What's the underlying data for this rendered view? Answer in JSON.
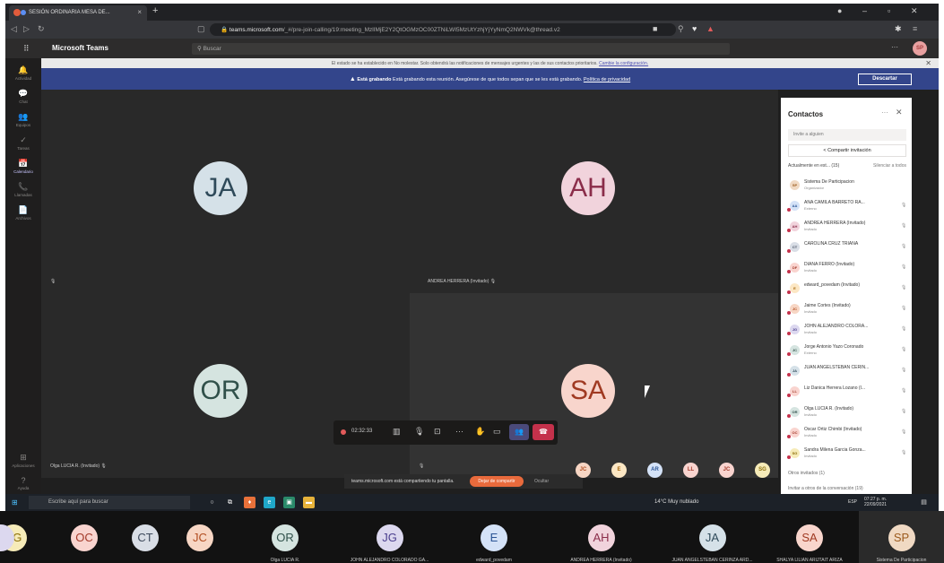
{
  "browser": {
    "tab_title": "SESIÓN ORDINARIA MESA DE...",
    "url_host": "teams.microsoft.com",
    "url_path": "/_#/pre-join-calling/19:meeting_MzlIMjE2Y2QtOGMzOC00ZTNiLWI5MzUtYzhjYjYyNmQ2NWVk@thread.v2"
  },
  "teams": {
    "app_title": "Microsoft Teams",
    "search_placeholder": "Buscar",
    "user_initials": "SP",
    "rail": [
      "Actividad",
      "Chat",
      "Equipos",
      "Tareas",
      "Calendario",
      "Llamadas",
      "Archivos",
      "Aplicaciones",
      "Ayuda"
    ]
  },
  "notice": {
    "text": "El estado se ha establecido en No molestar. Solo obtendrá las notificaciones de mensajes urgentes y las de sus contactos prioritarios.",
    "link": "Cambie la configuración."
  },
  "recording": {
    "bold": "Está grabando",
    "text": "Está grabando esta reunión. Asegúrese de que todos sepan que se les está grabando.",
    "link": "Política de privacidad",
    "stop_label": "Descartar"
  },
  "tiles": [
    {
      "initials": "JA",
      "name": "",
      "bg": "#d5e1e8",
      "fg": "#2f4a5a"
    },
    {
      "initials": "AH",
      "name": "ANDREA HERRERA (Invitado)",
      "bg": "#f1d3dc",
      "fg": "#8b2d4a"
    },
    {
      "initials": "OR",
      "name": "Olga LUCIA R. (Invitado)",
      "bg": "#d5e4e0",
      "fg": "#30504a"
    },
    {
      "initials": "SA",
      "name": "",
      "bg": "#f8d5cc",
      "fg": "#a03a22"
    }
  ],
  "controls": {
    "timer": "02:32:33"
  },
  "share_banner": {
    "text": "teams.microsoft.com está compartiendo tu pantalla.",
    "stop": "Dejar de compartir",
    "hide": "Ocultar"
  },
  "mini_avatars": [
    {
      "initials": "JC",
      "bg": "#f7d6c4",
      "fg": "#b14c1f"
    },
    {
      "initials": "E",
      "bg": "#fce7c4",
      "fg": "#a3650a"
    },
    {
      "initials": "AR",
      "bg": "#d4e2f7",
      "fg": "#2b5596"
    },
    {
      "initials": "LL",
      "bg": "#f9d4cf",
      "fg": "#a33a2a"
    },
    {
      "initials": "JC",
      "bg": "#f9d4cf",
      "fg": "#a33a2a"
    },
    {
      "initials": "SG",
      "bg": "#f6ebb8",
      "fg": "#8a6d08"
    }
  ],
  "panel": {
    "title": "Contactos",
    "invite_placeholder": "Invite a alguien",
    "share_invite": "Compartir invitación",
    "in_meeting": "Actualmente en est... (15)",
    "mute_all": "Silenciar a todos",
    "participants": [
      {
        "initials": "SP",
        "name": "Sistema De Participacion",
        "role": "Organizador",
        "bg": "#f0d9c3",
        "fg": "#9c5b1e"
      },
      {
        "initials": "AA",
        "name": "ANA CAMILA BARRETO RA...",
        "role": "Externo",
        "bg": "#d4e2f7",
        "fg": "#2b5596"
      },
      {
        "initials": "AH",
        "name": "ANDREA HERRERA (Invitado)",
        "role": "Invitado",
        "bg": "#f1d3dc",
        "fg": "#8b2d4a"
      },
      {
        "initials": "CT",
        "name": "CAROLINA CRUZ TRIANA",
        "role": "",
        "bg": "#d9dee6",
        "fg": "#3e4a5c"
      },
      {
        "initials": "DF",
        "name": "DIANA FERRO (Invitado)",
        "role": "Invitado",
        "bg": "#f9d4cf",
        "fg": "#a33a2a"
      },
      {
        "initials": "E",
        "name": "edward_povedam (Invitado)",
        "role": "",
        "bg": "#fce7c4",
        "fg": "#a3650a"
      },
      {
        "initials": "JC",
        "name": "Jaime Cortes (Invitado)",
        "role": "Invitado",
        "bg": "#f7d6c4",
        "fg": "#b14c1f"
      },
      {
        "initials": "JG",
        "name": "JOHN ALEJANDRO COLORA...",
        "role": "Invitado",
        "bg": "#dcd8ef",
        "fg": "#4b3f8f"
      },
      {
        "initials": "JC",
        "name": "Jorge Antonio Yazo Coronado",
        "role": "Externo",
        "bg": "#d5e4e0",
        "fg": "#30504a"
      },
      {
        "initials": "JA",
        "name": "JUAN ANGELSTEBAN CERIN...",
        "role": "",
        "bg": "#d5e1e8",
        "fg": "#2f4a5a"
      },
      {
        "initials": "LL",
        "name": "Liz Danica Herrera Lozano (I...",
        "role": "",
        "bg": "#f9d4cf",
        "fg": "#a33a2a"
      },
      {
        "initials": "OR",
        "name": "Olga LUCIA R. (Invitado)",
        "role": "Invitado",
        "bg": "#d5e4e0",
        "fg": "#30504a"
      },
      {
        "initials": "OC",
        "name": "Oscar Ortiz Chimbi (Invitado)",
        "role": "Invitado",
        "bg": "#f9d4cf",
        "fg": "#a33a2a"
      },
      {
        "initials": "SG",
        "name": "Sandra Milena Garcia Gonza...",
        "role": "Invitado",
        "bg": "#f6ebb8",
        "fg": "#8a6d08"
      }
    ],
    "others": "Otros invitados (1)",
    "invite_chat": "Invitar a otros de la conversación (19)"
  },
  "taskbar": {
    "search": "Escribe aquí para buscar",
    "weather": "14°C  Muy nublado",
    "lang": "ESP",
    "time": "07:27 p. m.",
    "date": "22/09/2021"
  },
  "gallery": [
    {
      "initials": "SG",
      "name": "",
      "bg": "#f6ebb8",
      "fg": "#8a6d08"
    },
    {
      "initials": "OC",
      "name": "",
      "bg": "#f9d4cf",
      "fg": "#a33a2a"
    },
    {
      "initials": "CT",
      "name": "",
      "bg": "#d9dee6",
      "fg": "#3e4a5c"
    },
    {
      "initials": "JC",
      "name": "",
      "bg": "#f7d6c4",
      "fg": "#b14c1f"
    },
    {
      "initials": "OR",
      "name": "Olga LUCIA R.",
      "bg": "#d5e4e0",
      "fg": "#30504a"
    },
    {
      "initials": "JG",
      "name": "JOHN ALEJANDRO COLORADO GA...",
      "bg": "#dcd8ef",
      "fg": "#4b3f8f"
    },
    {
      "initials": "E",
      "name": "edward_povedam",
      "bg": "#d4e2f7",
      "fg": "#2b5596"
    },
    {
      "initials": "AH",
      "name": "ANDREA HERRERA (Invitado)",
      "bg": "#f1d3dc",
      "fg": "#8b2d4a"
    },
    {
      "initials": "JA",
      "name": "JUAN ANGELSTEBAN CERINZA ARD...",
      "bg": "#d5e1e8",
      "fg": "#2f4a5a"
    },
    {
      "initials": "SA",
      "name": "SHALYA LILIAN ARIJTAIT ARIZA",
      "bg": "#f8d5cc",
      "fg": "#a03a22"
    },
    {
      "initials": "SP",
      "name": "Sistema De Participacion",
      "bg": "#f0d9c3",
      "fg": "#9c5b1e"
    }
  ]
}
